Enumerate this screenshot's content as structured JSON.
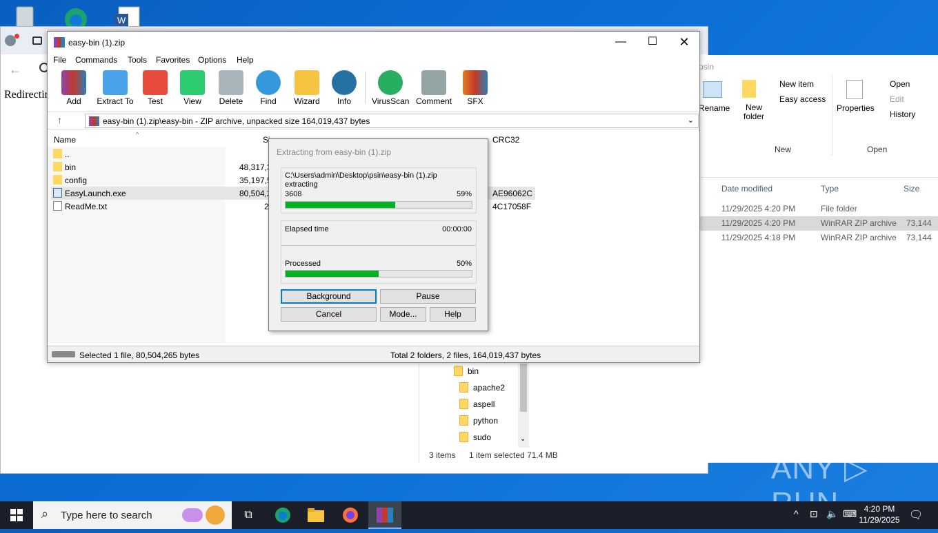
{
  "desktop": {
    "icons": [
      "recycle-bin-icon",
      "edge-icon",
      "word-icon"
    ]
  },
  "browser": {
    "page_text": "Redirectin"
  },
  "explorer": {
    "path_fragment": "psin",
    "ribbon": {
      "rename": "Rename",
      "new_folder": "New folder",
      "new_item": "New item",
      "easy_access": "Easy access",
      "new_group": "New",
      "properties": "Properties",
      "open": "Open",
      "edit": "Edit",
      "history": "History",
      "open_group": "Open"
    },
    "columns": {
      "date": "Date modified",
      "type": "Type",
      "size": "Size"
    },
    "rows": [
      {
        "date": "11/29/2025 4:20 PM",
        "type": "File folder",
        "size": ""
      },
      {
        "date": "11/29/2025 4:20 PM",
        "type": "WinRAR ZIP archive",
        "size": "73,144"
      },
      {
        "date": "11/29/2025 4:18 PM",
        "type": "WinRAR ZIP archive",
        "size": "73,144"
      }
    ],
    "tree": [
      {
        "label": "bin"
      },
      {
        "label": "apache2"
      },
      {
        "label": "aspell"
      },
      {
        "label": "python"
      },
      {
        "label": "sudo"
      }
    ],
    "status_items": "3 items",
    "status_selected": "1 item selected  71.4 MB"
  },
  "winrar": {
    "title": "easy-bin (1).zip",
    "menu": [
      "File",
      "Commands",
      "Tools",
      "Favorites",
      "Options",
      "Help"
    ],
    "tools": [
      {
        "label": "Add",
        "color": "#c0392b"
      },
      {
        "label": "Extract To",
        "color": "#2e86de"
      },
      {
        "label": "Test",
        "color": "#e74c3c"
      },
      {
        "label": "View",
        "color": "#27ae60"
      },
      {
        "label": "Delete",
        "color": "#95a5a6"
      },
      {
        "label": "Find",
        "color": "#2980b9"
      },
      {
        "label": "Wizard",
        "color": "#f39c12"
      },
      {
        "label": "Info",
        "color": "#2471a3"
      },
      {
        "label": "VirusScan",
        "color": "#229954"
      },
      {
        "label": "Comment",
        "color": "#7f8c8d"
      },
      {
        "label": "SFX",
        "color": "#d35400"
      }
    ],
    "address": "easy-bin (1).zip\\easy-bin - ZIP archive, unpacked size 164,019,437 bytes",
    "columns": {
      "name": "Name",
      "size": "Si",
      "crc": "CRC32"
    },
    "files": [
      {
        "name": "..",
        "size": "",
        "crc": "",
        "kind": "folder"
      },
      {
        "name": "bin",
        "size": "48,317,3",
        "crc": "",
        "kind": "folder"
      },
      {
        "name": "config",
        "size": "35,197,5",
        "crc": "",
        "kind": "folder"
      },
      {
        "name": "EasyLaunch.exe",
        "size": "80,504,2",
        "crc": "AE96062C",
        "kind": "exe"
      },
      {
        "name": "ReadMe.txt",
        "size": "2",
        "crc": "4C17058F",
        "kind": "txt"
      }
    ],
    "status_left": "Selected 1 file, 80,504,265 bytes",
    "status_right": "Total 2 folders, 2 files, 164,019,437 bytes"
  },
  "dialog": {
    "title": "Extracting from easy-bin (1).zip",
    "path": "C:\\Users\\admin\\Desktop\\psin\\easy-bin (1).zip",
    "action": "extracting",
    "current": "3608",
    "current_pct_label": "59%",
    "current_progress": 0.59,
    "elapsed_label": "Elapsed time",
    "elapsed_value": "00:00:00",
    "processed_label": "Processed",
    "processed_pct_label": "50%",
    "processed_progress": 0.5,
    "buttons": {
      "background": "Background",
      "pause": "Pause",
      "cancel": "Cancel",
      "mode": "Mode...",
      "help": "Help"
    }
  },
  "taskbar": {
    "search_placeholder": "Type here to search",
    "time": "4:20 PM",
    "date": "11/29/2025"
  },
  "watermark": "ANY RUN"
}
